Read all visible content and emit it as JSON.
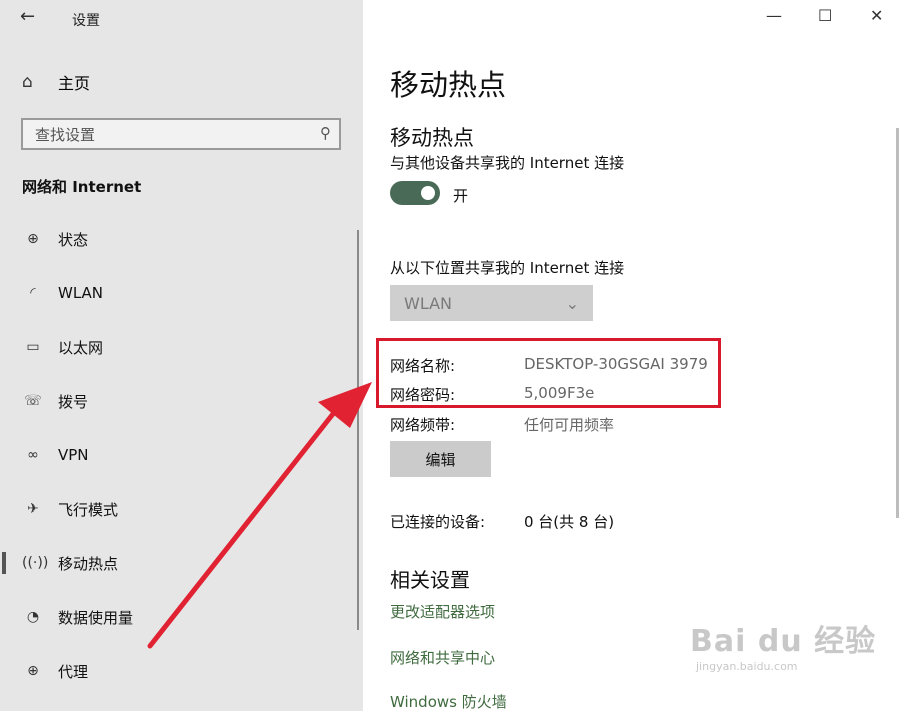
{
  "window": {
    "title": "设置",
    "back_icon": "←",
    "minimize": "—",
    "maximize": "☐",
    "close": "✕"
  },
  "sidebar": {
    "home_label": "主页",
    "search_placeholder": "查找设置",
    "section_title": "网络和 Internet",
    "items": [
      {
        "label": "状态",
        "icon": "globe-icon"
      },
      {
        "label": "WLAN",
        "icon": "wifi-icon"
      },
      {
        "label": "以太网",
        "icon": "ethernet-icon"
      },
      {
        "label": "拨号",
        "icon": "dialup-icon"
      },
      {
        "label": "VPN",
        "icon": "vpn-icon"
      },
      {
        "label": "飞行模式",
        "icon": "airplane-icon"
      },
      {
        "label": "移动热点",
        "icon": "hotspot-icon",
        "active": true
      },
      {
        "label": "数据使用量",
        "icon": "data-usage-icon"
      },
      {
        "label": "代理",
        "icon": "proxy-globe-icon"
      }
    ]
  },
  "main": {
    "page_title": "移动热点",
    "hotspot_title": "移动热点",
    "share_desc": "与其他设备共享我的 Internet 连接",
    "toggle_state": "开",
    "share_from_label": "从以下位置共享我的 Internet 连接",
    "share_from_value": "WLAN",
    "network_name_label": "网络名称:",
    "network_name_value": "DESKTOP-30GSGAI 3979",
    "network_password_label": "网络密码:",
    "network_password_value": "5,009F3e",
    "network_band_label": "网络频带:",
    "network_band_value": "任何可用频率",
    "edit_button": "编辑",
    "connected_label": "已连接的设备:",
    "connected_value": "0 台(共 8 台)",
    "related_title": "相关设置",
    "links": [
      "更改适配器选项",
      "网络和共享中心",
      "Windows 防火墙"
    ]
  },
  "watermark": {
    "main": "Bai du 经验",
    "sub": "jingyan.baidu.com"
  },
  "colors": {
    "accent_toggle": "#4a6a58",
    "highlight_red": "#d7192b",
    "link_green": "#3f6b3f"
  }
}
